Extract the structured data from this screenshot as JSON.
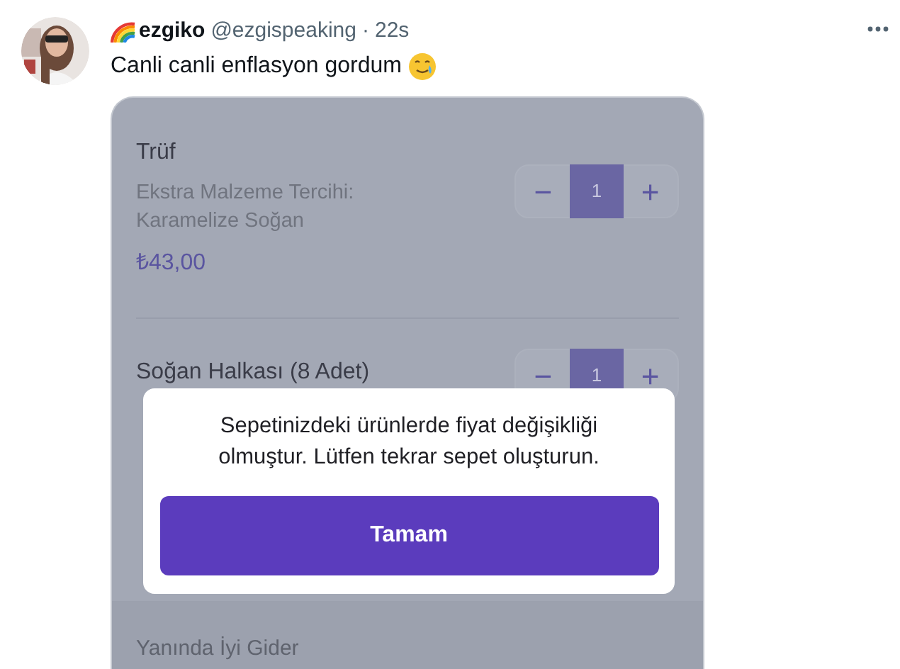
{
  "tweet": {
    "name": "ezgiko",
    "handle": "@ezgispeaking",
    "separator": "·",
    "time": "22s",
    "text": "Canli canli enflasyon gordum"
  },
  "cart": {
    "items": [
      {
        "name": "Trüf",
        "option": "Ekstra Malzeme Tercihi: Karamelize Soğan",
        "price": "₺43,00",
        "minus": "−",
        "quantity": "1",
        "plus": "+"
      },
      {
        "name": "Soğan Halkası (8 Adet)",
        "minus": "−",
        "quantity": "1",
        "plus": "+"
      }
    ],
    "section": "Yanında İyi Gider"
  },
  "dialog": {
    "message": "Sepetinizdeki ürünlerde fiyat değişikliği olmuştur. Lütfen tekrar sepet oluşturun.",
    "button": "Tamam"
  }
}
